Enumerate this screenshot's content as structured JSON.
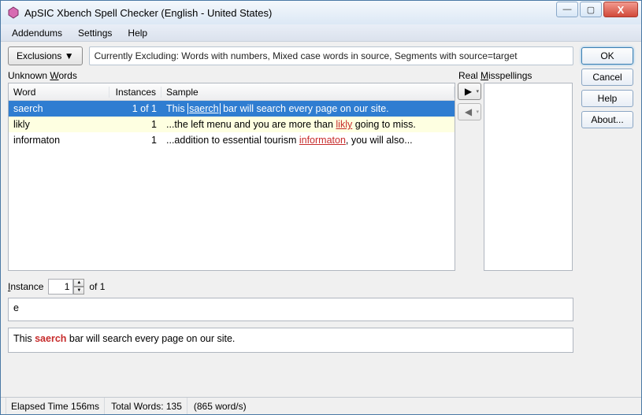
{
  "window": {
    "title": "ApSIC Xbench Spell Checker (English - United States)"
  },
  "winctl": {
    "min": "—",
    "max": "▢",
    "close": "X"
  },
  "menu": {
    "addendums": "Addendums",
    "settings": "Settings",
    "help": "Help"
  },
  "toolbar": {
    "exclusions_label": "Exclusions ▼",
    "excluding_text": "Currently Excluding: Words with numbers, Mixed case words in source, Segments with source=target"
  },
  "labels": {
    "unknown_words_pre": "Unknown ",
    "unknown_words_u": "W",
    "unknown_words_post": "ords",
    "real_pre": "Real ",
    "real_u": "M",
    "real_post": "isspellings"
  },
  "table": {
    "headers": {
      "word": "Word",
      "instances": "Instances",
      "sample": "Sample"
    },
    "rows": [
      {
        "word": "saerch",
        "instances": "1 of 1",
        "sample_pre": "This ",
        "sample_miss": "saerch",
        "sample_post": " bar will search every page on our site.",
        "selected": true,
        "boxed": true
      },
      {
        "word": "likly",
        "instances": "1",
        "sample_pre": "...the left menu and you are more than ",
        "sample_miss": "likly",
        "sample_post": " going to miss.",
        "selected": false,
        "alt": true
      },
      {
        "word": "informaton",
        "instances": "1",
        "sample_pre": "...addition to essential tourism ",
        "sample_miss": "informaton",
        "sample_post": ", you will also...",
        "selected": false
      }
    ]
  },
  "arrows": {
    "right": "▶",
    "left": "◀",
    "dd": "▾"
  },
  "instance": {
    "label_pre": "I",
    "label_post": "nstance",
    "value": "1",
    "of": "of 1"
  },
  "box1": {
    "text": "e"
  },
  "box2": {
    "pre": "This ",
    "miss": "saerch",
    "post": " bar will search every page on our site."
  },
  "buttons": {
    "ok": "OK",
    "cancel": "Cancel",
    "help": "Help",
    "about": "About..."
  },
  "status": {
    "elapsed": "Elapsed Time 156ms",
    "total": "Total Words: 135",
    "rate": "(865 word/s)"
  }
}
